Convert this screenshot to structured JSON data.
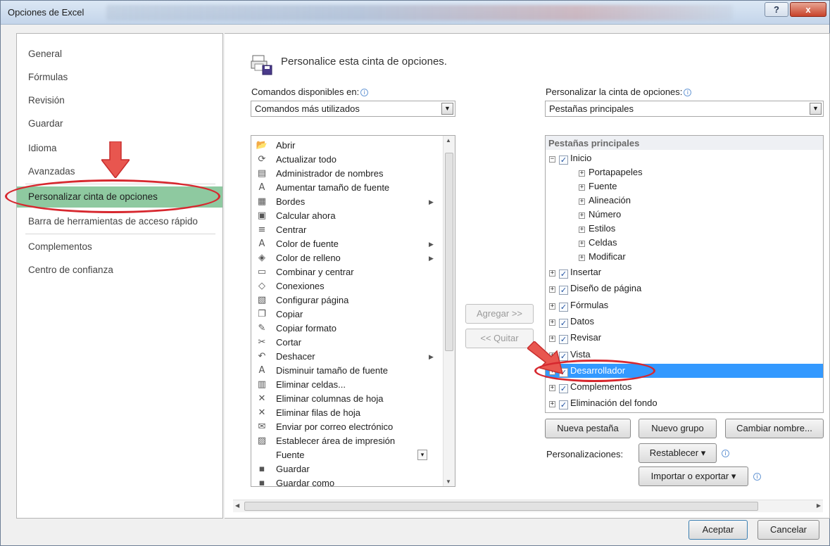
{
  "window": {
    "title": "Opciones de Excel",
    "help_glyph": "?",
    "close_glyph": "x"
  },
  "nav": {
    "items": [
      {
        "label": "General"
      },
      {
        "label": "Fórmulas"
      },
      {
        "label": "Revisión"
      },
      {
        "label": "Guardar"
      },
      {
        "label": "Idioma"
      },
      {
        "label": "Avanzadas"
      },
      {
        "label": "Personalizar cinta de opciones",
        "selected": true
      },
      {
        "label": "Barra de herramientas de acceso rápido"
      },
      {
        "label": "Complementos"
      },
      {
        "label": "Centro de confianza"
      }
    ]
  },
  "header": {
    "title": "Personalice esta cinta de opciones."
  },
  "commands": {
    "label": "Comandos disponibles en:",
    "selected": "Comandos más utilizados",
    "items": [
      {
        "label": "Abrir",
        "icon": "folder-icon",
        "glyph": "📂"
      },
      {
        "label": "Actualizar todo",
        "icon": "refresh-all-icon",
        "glyph": "⟳"
      },
      {
        "label": "Administrador de nombres",
        "icon": "name-manager-icon",
        "glyph": "▤"
      },
      {
        "label": "Aumentar tamaño de fuente",
        "icon": "font-grow-icon",
        "glyph": "A"
      },
      {
        "label": "Bordes",
        "icon": "borders-icon",
        "glyph": "▦",
        "submenu": true
      },
      {
        "label": "Calcular ahora",
        "icon": "calculator-icon",
        "glyph": "▣"
      },
      {
        "label": "Centrar",
        "icon": "center-align-icon",
        "glyph": "≡"
      },
      {
        "label": "Color de fuente",
        "icon": "font-color-icon",
        "glyph": "A",
        "submenu": true
      },
      {
        "label": "Color de relleno",
        "icon": "fill-color-icon",
        "glyph": "◈",
        "submenu": true
      },
      {
        "label": "Combinar y centrar",
        "icon": "merge-center-icon",
        "glyph": "▭"
      },
      {
        "label": "Conexiones",
        "icon": "connections-icon",
        "glyph": "◇"
      },
      {
        "label": "Configurar página",
        "icon": "page-setup-icon",
        "glyph": "▧"
      },
      {
        "label": "Copiar",
        "icon": "copy-icon",
        "glyph": "❐"
      },
      {
        "label": "Copiar formato",
        "icon": "format-painter-icon",
        "glyph": "✎"
      },
      {
        "label": "Cortar",
        "icon": "scissors-icon",
        "glyph": "✂"
      },
      {
        "label": "Deshacer",
        "icon": "undo-icon",
        "glyph": "↶",
        "submenu": true
      },
      {
        "label": "Disminuir tamaño de fuente",
        "icon": "font-shrink-icon",
        "glyph": "A"
      },
      {
        "label": "Eliminar celdas...",
        "icon": "delete-cells-icon",
        "glyph": "▥"
      },
      {
        "label": "Eliminar columnas de hoja",
        "icon": "delete-columns-icon",
        "glyph": "✕"
      },
      {
        "label": "Eliminar filas de hoja",
        "icon": "delete-rows-icon",
        "glyph": "✕"
      },
      {
        "label": "Enviar por correo electrónico",
        "icon": "email-icon",
        "glyph": "✉"
      },
      {
        "label": "Establecer área de impresión",
        "icon": "print-area-icon",
        "glyph": "▨"
      },
      {
        "label": "Fuente",
        "icon": "font-icon",
        "glyph": "",
        "combo": true
      },
      {
        "label": "Guardar",
        "icon": "save-icon",
        "glyph": "▪"
      },
      {
        "label": "Guardar como",
        "icon": "save-as-icon",
        "glyph": "▪"
      }
    ]
  },
  "ribbon": {
    "label": "Personalizar la cinta de opciones:",
    "selected": "Pestañas principales",
    "tree_header": "Pestañas principales",
    "tabs": [
      {
        "label": "Inicio",
        "expanded": true,
        "checked": true,
        "groups": [
          "Portapapeles",
          "Fuente",
          "Alineación",
          "Número",
          "Estilos",
          "Celdas",
          "Modificar"
        ]
      },
      {
        "label": "Insertar",
        "checked": true
      },
      {
        "label": "Diseño de página",
        "checked": true
      },
      {
        "label": "Fórmulas",
        "checked": true
      },
      {
        "label": "Datos",
        "checked": true
      },
      {
        "label": "Revisar",
        "checked": true
      },
      {
        "label": "Vista",
        "checked": true
      },
      {
        "label": "Desarrollador",
        "checked": true,
        "selected": true
      },
      {
        "label": "Complementos",
        "checked": true
      },
      {
        "label": "Eliminación del fondo",
        "checked": true
      }
    ]
  },
  "buttons": {
    "add": "Agregar >>",
    "remove": "<< Quitar",
    "new_tab": "Nueva pestaña",
    "new_group": "Nuevo grupo",
    "rename": "Cambiar nombre...",
    "customizations_label": "Personalizaciones:",
    "reset": "Restablecer ▾",
    "import_export": "Importar o exportar ▾",
    "ok": "Aceptar",
    "cancel": "Cancelar"
  },
  "colors": {
    "nav_selected": "#8ec9a0",
    "tree_selected": "#3399ff",
    "annotation_red": "#d7282f"
  }
}
